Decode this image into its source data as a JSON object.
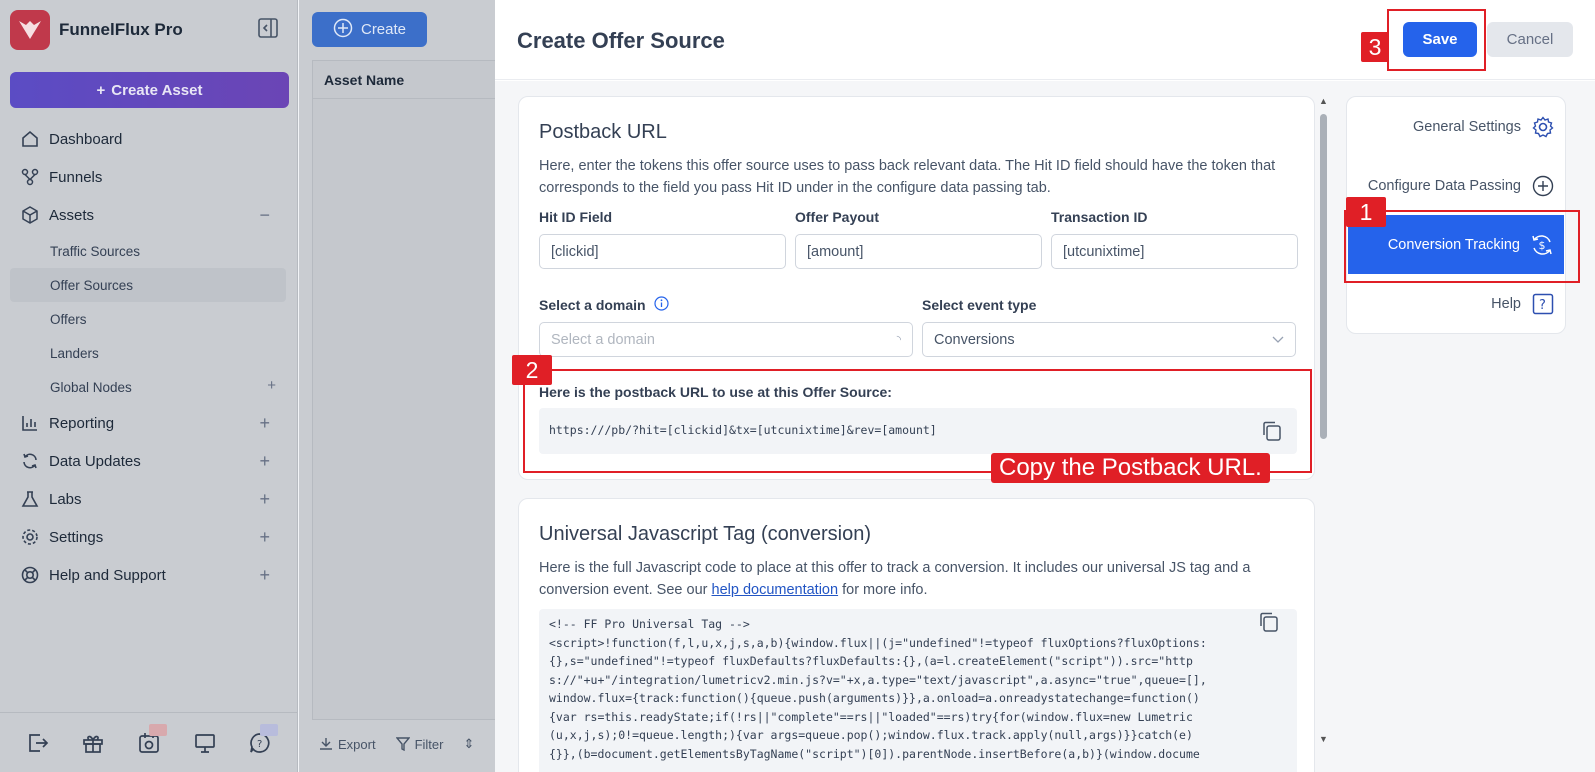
{
  "brand": {
    "name": "FunnelFlux Pro"
  },
  "sidebar": {
    "create_asset_label": "Create Asset",
    "items": [
      {
        "label": "Dashboard",
        "icon": "home-icon"
      },
      {
        "label": "Funnels",
        "icon": "funnel-icon"
      },
      {
        "label": "Assets",
        "icon": "cube-icon",
        "expanded": true
      },
      {
        "label": "Reporting",
        "icon": "chart-icon"
      },
      {
        "label": "Data Updates",
        "icon": "refresh-icon"
      },
      {
        "label": "Labs",
        "icon": "flask-icon"
      },
      {
        "label": "Settings",
        "icon": "gear-icon"
      },
      {
        "label": "Help and Support",
        "icon": "lifebuoy-icon"
      }
    ],
    "sub_items": [
      {
        "label": "Traffic Sources"
      },
      {
        "label": "Offer Sources",
        "active": true
      },
      {
        "label": "Offers"
      },
      {
        "label": "Landers"
      },
      {
        "label": "Global Nodes"
      }
    ]
  },
  "background_page": {
    "create_label": "Create",
    "column_header": "Asset Name",
    "tools": {
      "export": "Export",
      "filter": "Filter"
    }
  },
  "modal": {
    "title": "Create Offer Source",
    "save_label": "Save",
    "cancel_label": "Cancel",
    "postback": {
      "heading": "Postback URL",
      "description": "Here, enter the tokens this offer source uses to pass back relevant data. The Hit ID field should have the token that corresponds to the field you pass Hit ID under in the configure data passing tab.",
      "hit_id_label": "Hit ID Field",
      "hit_id_value": "[clickid]",
      "payout_label": "Offer Payout",
      "payout_value": "[amount]",
      "transaction_label": "Transaction ID",
      "transaction_value": "[utcunixtime]",
      "domain_label": "Select a domain",
      "domain_placeholder": "Select a domain",
      "event_label": "Select event type",
      "event_value": "Conversions",
      "url_label": "Here is the postback URL to use at this Offer Source:",
      "url_value": "https:///pb/?hit=[clickid]&tx=[utcunixtime]&rev=[amount]"
    },
    "js_tag": {
      "heading": "Universal Javascript Tag (conversion)",
      "description_pre": "Here is the full Javascript code to place at this offer to track a conversion. It includes our universal JS tag and a conversion event. See our ",
      "link_text": "help documentation",
      "description_post": " for more info.",
      "code": "<!-- FF Pro Universal Tag -->\n<script>!function(f,l,u,x,j,s,a,b){window.flux||(j=\"undefined\"!=typeof fluxOptions?fluxOptions:\n{},s=\"undefined\"!=typeof fluxDefaults?fluxDefaults:{},(a=l.createElement(\"script\")).src=\"http\ns://\"+u+\"/integration/lumetricv2.min.js?v=\"+x,a.type=\"text/javascript\",a.async=\"true\",queue=[],\nwindow.flux={track:function(){queue.push(arguments)}},a.onload=a.onreadystatechange=function()\n{var rs=this.readyState;if(!rs||\"complete\"==rs||\"loaded\"==rs)try{for(window.flux=new Lumetric\n(u,x,j,s);0!=queue.length;){var args=queue.pop();window.flux.track.apply(null,args)}}catch(e)\n{}},(b=document.getElementsByTagName(\"script\")[0]).parentNode.insertBefore(a,b)}(window.docume"
    },
    "tabs": [
      {
        "label": "General Settings",
        "icon": "gear-icon"
      },
      {
        "label": "Configure Data Passing",
        "icon": "plus-circle-icon"
      },
      {
        "label": "Conversion Tracking",
        "icon": "dollar-cycle-icon",
        "active": true
      },
      {
        "label": "Help",
        "icon": "question-icon"
      }
    ]
  },
  "annotations": {
    "badge_1": "1",
    "badge_2": "2",
    "badge_3": "3",
    "callout": "Copy the Postback URL.",
    "color": "#e01f26"
  },
  "colors": {
    "accent": "#2563eb",
    "brand": "#c0394b"
  }
}
